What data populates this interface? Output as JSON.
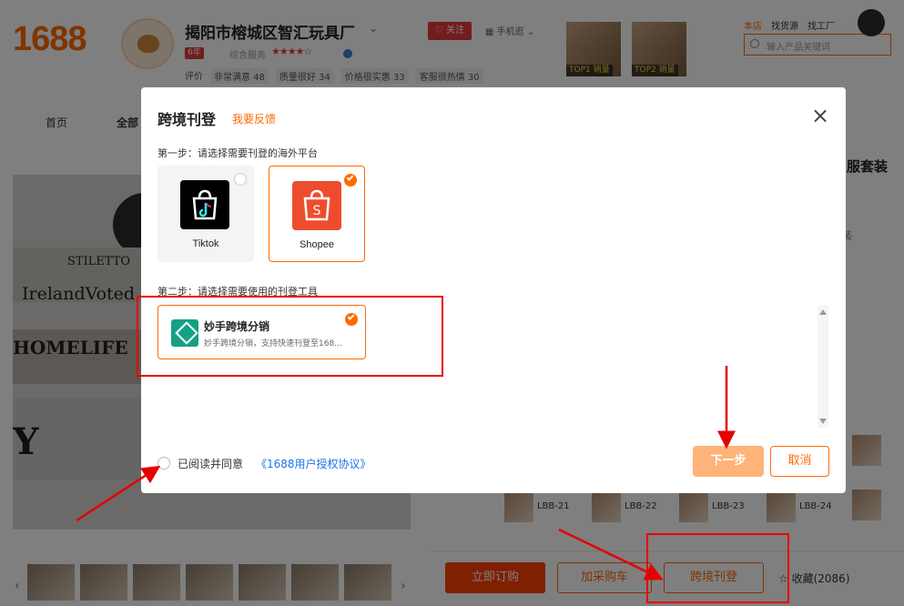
{
  "header": {
    "logo": "1688",
    "shop_name": "揭阳市榕城区智汇玩具厂",
    "follow_label": "关注",
    "mobile_link": "手机逛",
    "year_badge": "6年",
    "service_label": "综合服务",
    "ratings": [
      "评价",
      "非常满意 48",
      "质量很好 34",
      "价格很实惠 33",
      "客服很热情 30"
    ],
    "top_thumbs": [
      "TOP1 销量",
      "TOP2 销量"
    ],
    "store_links": [
      "本店",
      "找货源",
      "找工厂"
    ],
    "search_placeholder": "输入产品关键词"
  },
  "nav": [
    "首页",
    "全部"
  ],
  "photo_text": [
    "STILETTO",
    "IrelandVoted",
    "HOMELIFE",
    "Y"
  ],
  "side_title": "服套装",
  "side_fragment": "装",
  "sku_items": [
    "LBB-21",
    "LBB-22",
    "LBB-23",
    "LBB-24"
  ],
  "action_bar": {
    "order": "立即订购",
    "cart": "加采购车",
    "cross_border": "跨境刊登",
    "collect": "收藏(2086)"
  },
  "modal": {
    "title": "跨境刊登",
    "feedback": "我要反馈",
    "step1": "第一步：请选择需要刊登的海外平台",
    "platforms": [
      {
        "name": "Tiktok",
        "selected": false
      },
      {
        "name": "Shopee",
        "selected": true
      }
    ],
    "step2": "第二步：请选择需要使用的刊登工具",
    "tool": {
      "name": "妙手跨境分销",
      "desc": "妙手跨境分销，支持快速刊登至168...",
      "selected": true
    },
    "agree_text": "已阅读并同意",
    "agree_link": "《1688用户授权协议》",
    "next_label": "下一步",
    "cancel_label": "取消"
  },
  "colors": {
    "brand": "#ff6a00",
    "link": "#1a73e8",
    "annotation": "#e60000"
  }
}
